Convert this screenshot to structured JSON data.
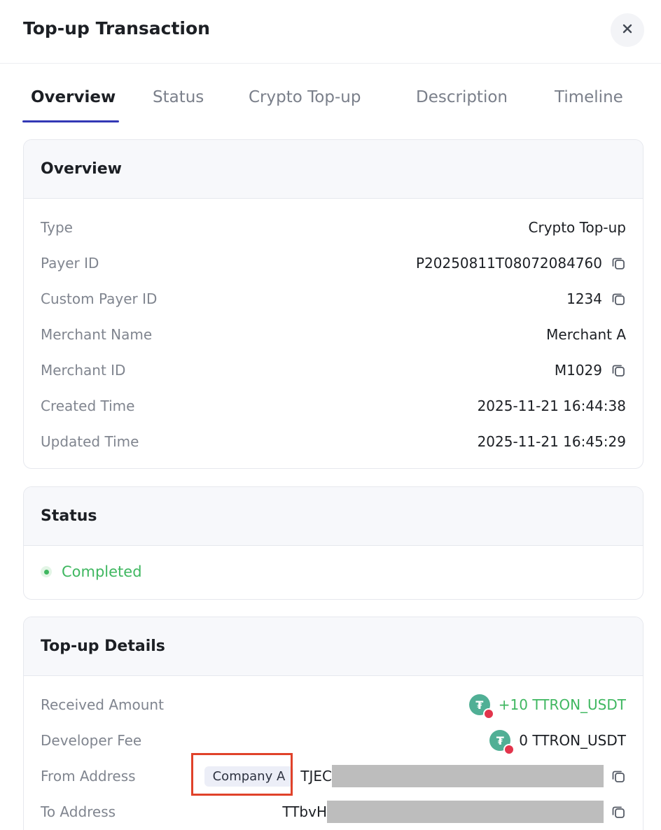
{
  "header": {
    "title": "Top-up Transaction",
    "close_icon": "close-icon"
  },
  "tabs": [
    {
      "label": "Overview",
      "active": true
    },
    {
      "label": "Status"
    },
    {
      "label": "Crypto Top-up"
    },
    {
      "label": "Description"
    },
    {
      "label": "Timeline"
    }
  ],
  "overview": {
    "title": "Overview",
    "rows": [
      {
        "label": "Type",
        "value": "Crypto Top-up"
      },
      {
        "label": "Payer ID",
        "value": "P20250811T08072084760",
        "copy": true
      },
      {
        "label": "Custom Payer ID",
        "value": "1234",
        "copy": true
      },
      {
        "label": "Merchant Name",
        "value": "Merchant A"
      },
      {
        "label": "Merchant ID",
        "value": "M1029",
        "copy": true
      },
      {
        "label": "Created Time",
        "value": "2025-11-21 16:44:38"
      },
      {
        "label": "Updated Time",
        "value": "2025-11-21 16:45:29"
      }
    ]
  },
  "status": {
    "title": "Status",
    "value": "Completed",
    "color": "#3fb760"
  },
  "topup": {
    "title": "Top-up Details",
    "received_label": "Received Amount",
    "received_value": "+10 TTRON_USDT",
    "fee_label": "Developer Fee",
    "fee_value": "0 TTRON_USDT",
    "from_label": "From Address",
    "from_tag": "Company A",
    "from_prefix": "TJEC",
    "to_label": "To Address",
    "to_prefix": "TTbvH",
    "token_icon": "tether-usdt-icon",
    "network_icon": "tron-icon"
  },
  "colors": {
    "accent": "#3338b5",
    "success": "#3fb760",
    "highlight": "#e0422a"
  }
}
